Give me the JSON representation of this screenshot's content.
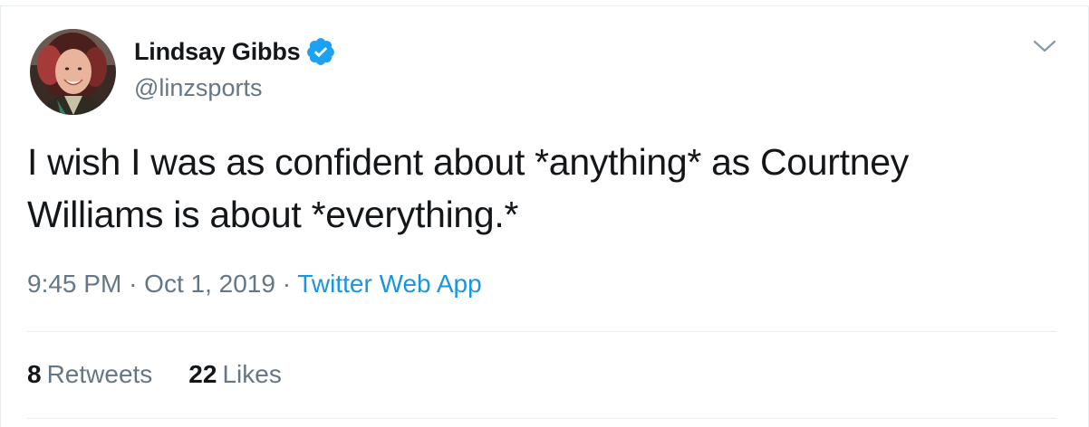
{
  "user": {
    "display_name": "Lindsay Gibbs",
    "handle": "@linzsports",
    "verified": true,
    "avatar_icon": "profile-photo",
    "verified_icon": "verified-badge-icon"
  },
  "tweet": {
    "text_line_1": "I wish I was as confident about *anything* as Courtney",
    "text_line_2": "Williams is about *everything.*",
    "time": "9:45 PM",
    "separator": "·",
    "date": "Oct 1, 2019",
    "source": "Twitter Web App"
  },
  "stats": {
    "retweets_count": "8",
    "retweets_label": "Retweets",
    "likes_count": "22",
    "likes_label": "Likes"
  },
  "colors": {
    "text": "#14171a",
    "secondary": "#657786",
    "accent": "#1b95e0",
    "divider": "#e6ecf0"
  },
  "menu_icon": "chevron-down-icon"
}
